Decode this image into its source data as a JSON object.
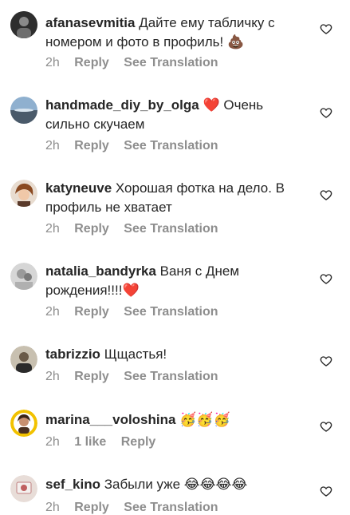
{
  "comments": [
    {
      "username": "afanasevmitia",
      "text": "Дайте ему табличку с номером и фото в профиль!",
      "emoji": "💩",
      "time": "2h",
      "likes": "",
      "reply": "Reply",
      "translate": "See Translation",
      "avatar_color": "#3a3a3a"
    },
    {
      "username": "handmade_diy_by_olga",
      "text": "Очень сильно скучаем",
      "emoji_before": "❤️",
      "time": "2h",
      "likes": "",
      "reply": "Reply",
      "translate": "See Translation",
      "avatar_color": "#7f9db8"
    },
    {
      "username": "katyneuve",
      "text": "Хорошая фотка на дело. В профиль не хватает",
      "time": "2h",
      "likes": "",
      "reply": "Reply",
      "translate": "See Translation",
      "avatar_color": "#a0653f"
    },
    {
      "username": "natalia_bandyrka",
      "text": "Ваня с Днем рождения!!!!",
      "emoji": "❤️",
      "time": "2h",
      "likes": "",
      "reply": "Reply",
      "translate": "See Translation",
      "avatar_color": "#b8b8b8"
    },
    {
      "username": "tabrizzio",
      "text": "Щщастья!",
      "time": "2h",
      "likes": "",
      "reply": "Reply",
      "translate": "See Translation",
      "avatar_color": "#8a8070"
    },
    {
      "username": "marina___voloshina",
      "text": "",
      "emoji": "🥳🥳🥳",
      "time": "2h",
      "likes": "1 like",
      "reply": "Reply",
      "translate": "",
      "avatar_color": "#e0b020"
    },
    {
      "username": "sef_kino",
      "text": "Забыли уже",
      "emoji": "😂😂😂😂",
      "time": "2h",
      "likes": "",
      "reply": "Reply",
      "translate": "See Translation",
      "avatar_color": "#d8c8c0"
    }
  ]
}
